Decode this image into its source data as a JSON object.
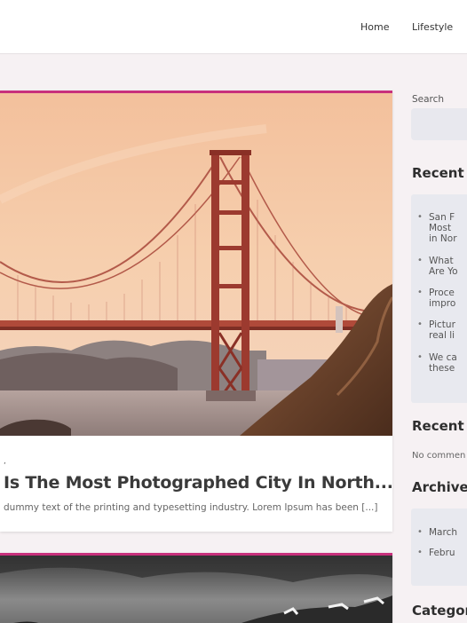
{
  "nav": {
    "home": "Home",
    "lifestyle": "Lifestyle"
  },
  "post1": {
    "meta": ",",
    "title": "Is The Most Photographed City In North...",
    "excerpt": "dummy text of the printing and typesetting industry. Lorem Ipsum has been [...]"
  },
  "sidebar": {
    "search_label": "Search",
    "recent_posts_title": "Recent Po",
    "recent_posts": [
      "San F\nMost\nin Nor",
      "What\nAre Yo",
      "Proce\nimpro",
      "Pictur\nreal li",
      "We ca\nthese"
    ],
    "recent_comments_title": "Recent Co",
    "no_comments": "No commen",
    "archives_title": "Archives",
    "archives": [
      "March",
      "Febru"
    ],
    "categories_title": "Categorie"
  },
  "colors": {
    "accent": "#c8307c",
    "page_bg": "#f6f1f3",
    "widget_bg": "#e8e9ef"
  }
}
